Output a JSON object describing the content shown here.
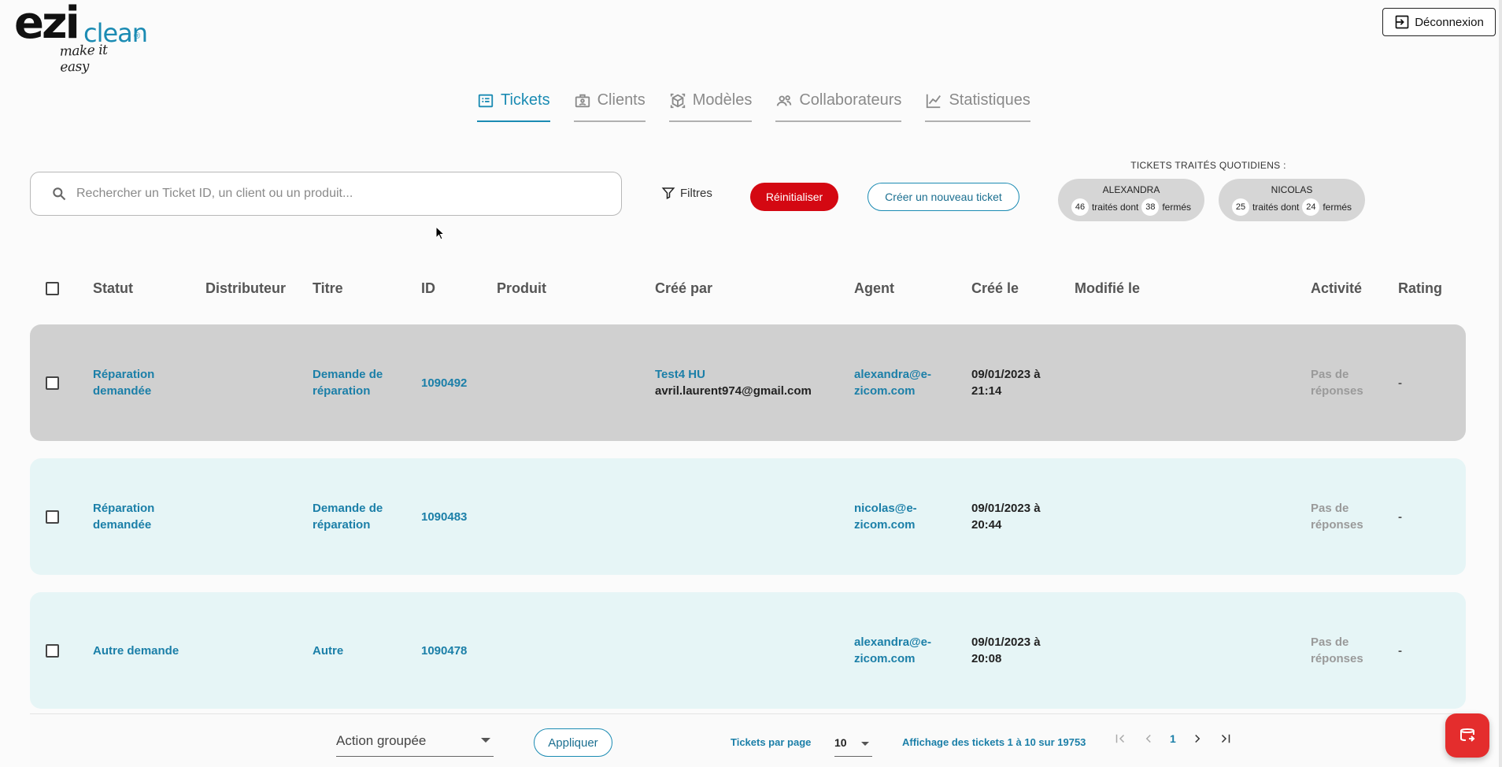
{
  "brand": {
    "logo_main": "ezi",
    "logo_sub": "clean",
    "logo_reg": "®",
    "tagline": "make it easy"
  },
  "header": {
    "logout_label": "Déconnexion"
  },
  "tabs": [
    {
      "label": "Tickets",
      "icon": "ticket-icon",
      "active": true
    },
    {
      "label": "Clients",
      "icon": "briefcase-icon",
      "active": false
    },
    {
      "label": "Modèles",
      "icon": "cube-icon",
      "active": false
    },
    {
      "label": "Collaborateurs",
      "icon": "users-icon",
      "active": false
    },
    {
      "label": "Statistiques",
      "icon": "chart-icon",
      "active": false
    }
  ],
  "toolbar": {
    "search_placeholder": "Rechercher un Ticket ID, un client ou un produit...",
    "filters_label": "Filtres",
    "reset_label": "Réinitialiser",
    "create_label": "Créer un nouveau ticket"
  },
  "daily": {
    "title": "TICKETS TRAITÉS QUOTIDIENS :",
    "treated_label": "traités dont",
    "closed_label": "fermés",
    "agents": [
      {
        "name": "ALEXANDRA",
        "treated": "46",
        "closed": "38"
      },
      {
        "name": "NICOLAS",
        "treated": "25",
        "closed": "24"
      }
    ]
  },
  "table": {
    "headers": {
      "status": "Statut",
      "distributor": "Distributeur",
      "title": "Titre",
      "id": "ID",
      "product": "Produit",
      "created_by": "Créé par",
      "agent": "Agent",
      "created_at": "Créé le",
      "modified_at": "Modifié le",
      "activity": "Activité",
      "rating": "Rating"
    },
    "rows": [
      {
        "status_1": "Réparation",
        "status_2": "demandée",
        "title_1": "Demande de",
        "title_2": "réparation",
        "id": "1090492",
        "creator_name": "Test4 HU",
        "creator_email": "avril.laurent974@gmail.com",
        "agent_1": "alexandra@e-",
        "agent_2": "zicom.com",
        "created_1": "09/01/2023 à",
        "created_2": "21:14",
        "activity_1": "Pas de",
        "activity_2": "réponses",
        "rating": "-"
      },
      {
        "status_1": "Réparation",
        "status_2": "demandée",
        "title_1": "Demande de",
        "title_2": "réparation",
        "id": "1090483",
        "agent_1": "nicolas@e-",
        "agent_2": "zicom.com",
        "created_1": "09/01/2023 à",
        "created_2": "20:44",
        "activity_1": "Pas de",
        "activity_2": "réponses",
        "rating": "-"
      },
      {
        "status": "Autre demande",
        "title": "Autre",
        "id": "1090478",
        "agent_1": "alexandra@e-",
        "agent_2": "zicom.com",
        "created_1": "09/01/2023 à",
        "created_2": "20:08",
        "activity_1": "Pas de",
        "activity_2": "réponses",
        "rating": "-"
      }
    ]
  },
  "footer": {
    "bulk_action_label": "Action groupée",
    "apply_label": "Appliquer",
    "per_page_label": "Tickets par page",
    "per_page_value": "10",
    "range_text": "Affichage des tickets 1 à 10 sur 19753",
    "current_page": "1"
  },
  "colors": {
    "accent": "#1b8bb3",
    "danger": "#d40812",
    "row_selected": "#d0d0d0",
    "row_bg": "#e6f5f6"
  }
}
